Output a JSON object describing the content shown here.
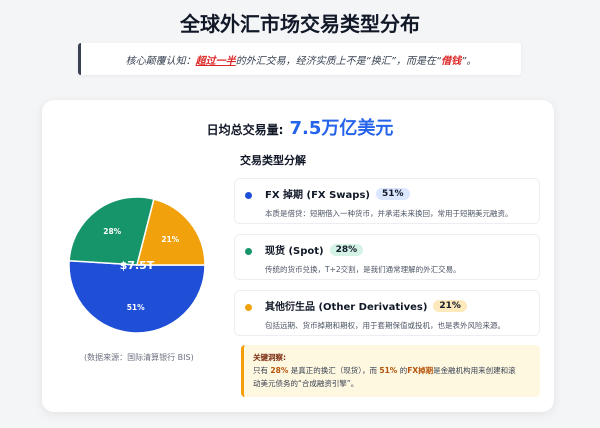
{
  "page": {
    "title": "全球外汇市场交易类型分布",
    "insight": {
      "prefix": "核心颠覆认知：",
      "emphasis": "超过一半",
      "middle": "的外汇交易，经济实质上不是“换汇”，而是在“",
      "emphasis2": "借钱",
      "suffix": "”。"
    }
  },
  "summary": {
    "label": "日均总交易量:",
    "value": "7.5万亿美元"
  },
  "chart_data": {
    "type": "pie",
    "center_label": "$7.5T",
    "slices": [
      {
        "name": "FX 掉期 (FX Swaps)",
        "value": 51,
        "label": "51%",
        "color": "#1f4fd6"
      },
      {
        "name": "现货 (Spot)",
        "value": 28,
        "label": "28%",
        "color": "#16956a"
      },
      {
        "name": "其他衍生品 (Other Derivatives)",
        "value": 21,
        "label": "21%",
        "color": "#f1a10c"
      }
    ],
    "source": "(数据来源：国际清算银行 BIS)"
  },
  "breakdown": {
    "title": "交易类型分解",
    "items": [
      {
        "name": "FX 掉期 (FX Swaps)",
        "pct": "51%",
        "color": "#1f4fd6",
        "badge_bg": "#dbe6ff",
        "desc": "本质是借贷：短期借入一种货币，并承诺未来换回，常用于短期美元融资。"
      },
      {
        "name": "现货 (Spot)",
        "pct": "28%",
        "color": "#16956a",
        "badge_bg": "#d4f3e6",
        "desc": "传统的货币兑换，T+2交割，是我们通常理解的外汇交易。"
      },
      {
        "name": "其他衍生品 (Other Derivatives)",
        "pct": "21%",
        "color": "#f1a10c",
        "badge_bg": "#fde9bb",
        "desc": "包括远期、货币掉期和期权，用于套期保值或投机，也是表外风险来源。"
      }
    ]
  },
  "key_insight": {
    "title": "关键洞察:",
    "line1_a": "只有",
    "line1_b": "28%",
    "line1_c": "是真正的换汇（现货），而",
    "line1_d": "51%",
    "line1_e": "的",
    "line1_f": "FX掉期",
    "line1_g": "是金融机构用来创建和滚",
    "line2": "动美元债务的“合成融资引擎”。"
  }
}
